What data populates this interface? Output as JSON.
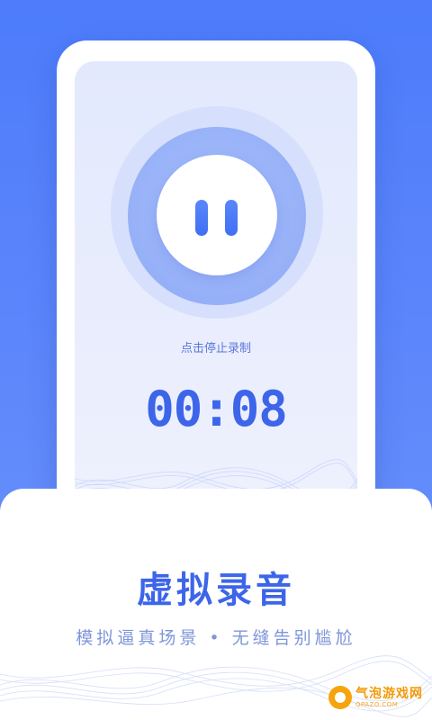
{
  "recorder": {
    "hint": "点击停止录制",
    "timer": "00:08",
    "state": "recording"
  },
  "promo": {
    "title": "虚拟录音",
    "subtitle": "模拟逼真场景 • 无缝告别尴尬"
  },
  "watermark": {
    "brand": "气泡游戏网",
    "domain": "QPAZO.COM"
  },
  "colors": {
    "background": "#4d7cfb",
    "accent": "#3d65ea",
    "subtitle": "#7f96d8",
    "watermark": "#f29a07"
  },
  "icons": {
    "pause": "pause-icon"
  }
}
